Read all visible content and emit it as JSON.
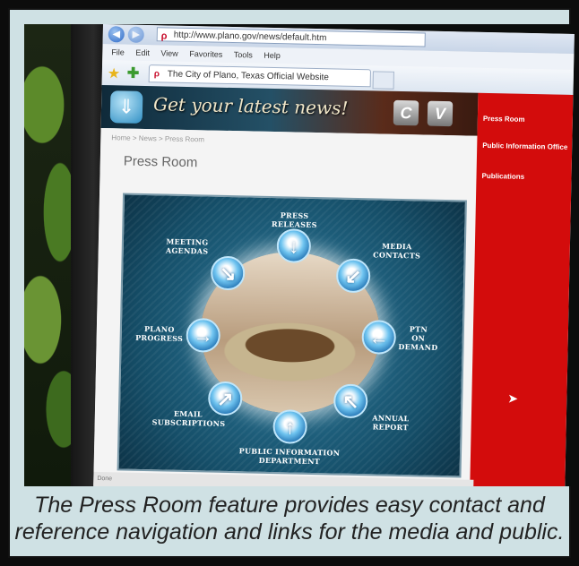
{
  "browser": {
    "url": "http://www.plano.gov/news/default.htm",
    "menu": [
      "File",
      "Edit",
      "View",
      "Favorites",
      "Tools",
      "Help"
    ],
    "tab_title": "The City of Plano, Texas Official Website",
    "status": "Done"
  },
  "banner": {
    "tagline": "Get your latest news!",
    "buttons": [
      "C",
      "V"
    ]
  },
  "page": {
    "breadcrumb": "Home > News > Press Room",
    "title": "Press Room"
  },
  "press_nav": [
    {
      "label": "Press Releases",
      "arrow": "↓"
    },
    {
      "label": "Media\nContacts",
      "arrow": "↙"
    },
    {
      "label": "PTN\nOn\nDemand",
      "arrow": "←"
    },
    {
      "label": "Annual\nReport",
      "arrow": "↖"
    },
    {
      "label": "Public Information\nDepartment",
      "arrow": "↑"
    },
    {
      "label": "Email\nSubscriptions",
      "arrow": "↗"
    },
    {
      "label": "Plano\nProgress",
      "arrow": "→"
    },
    {
      "label": "Meeting\nAgendas",
      "arrow": "↘"
    }
  ],
  "sidebar": {
    "links": [
      "Press Room",
      "Public Information Office",
      "Publications"
    ]
  },
  "caption": "The Press Room feature provides easy contact and reference navigation and links for the media and public."
}
